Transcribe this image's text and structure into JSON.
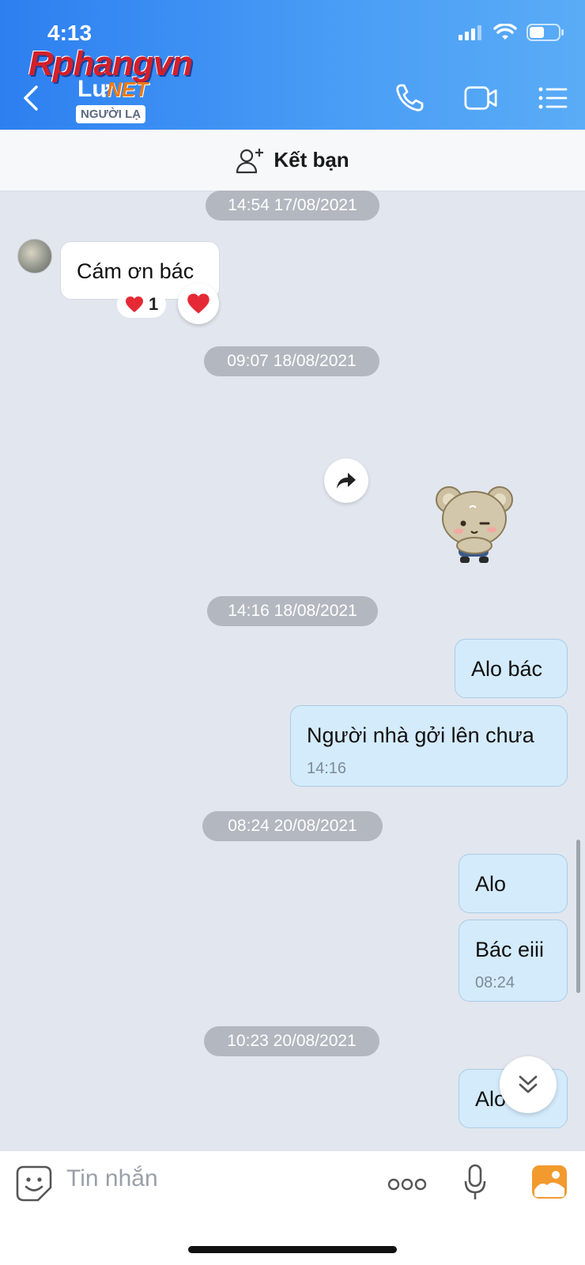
{
  "status_bar": {
    "time": "4:13"
  },
  "watermark": {
    "brand": "Rphangvn",
    "suffix": ".NET"
  },
  "header": {
    "contact_name": "Lư",
    "badge": "NGƯỜI LẠ",
    "icons": [
      "back-icon",
      "phone-icon",
      "video-icon",
      "menu-list-icon"
    ]
  },
  "add_friend": {
    "label": "Kết bạn"
  },
  "messages": {
    "d1": "14:54 17/08/2021",
    "m1": "Cám ơn bác",
    "m1_reaction_count": "1",
    "d2": "09:07 18/08/2021",
    "d3": "14:16 18/08/2021",
    "m3": "Alo bác",
    "m4": "Người nhà gởi lên chưa",
    "m4_time": "14:16",
    "d4": "08:24 20/08/2021",
    "m5": "Alo",
    "m6": "Bác eiii",
    "m6_time": "08:24",
    "d5": "10:23 20/08/2021",
    "m7": "Alo"
  },
  "composer": {
    "placeholder": "Tin nhắn"
  },
  "colors": {
    "header": "#3d93f3",
    "outgoing_bubble": "#d4ebfb",
    "chat_bg": "#e2e6ee"
  }
}
